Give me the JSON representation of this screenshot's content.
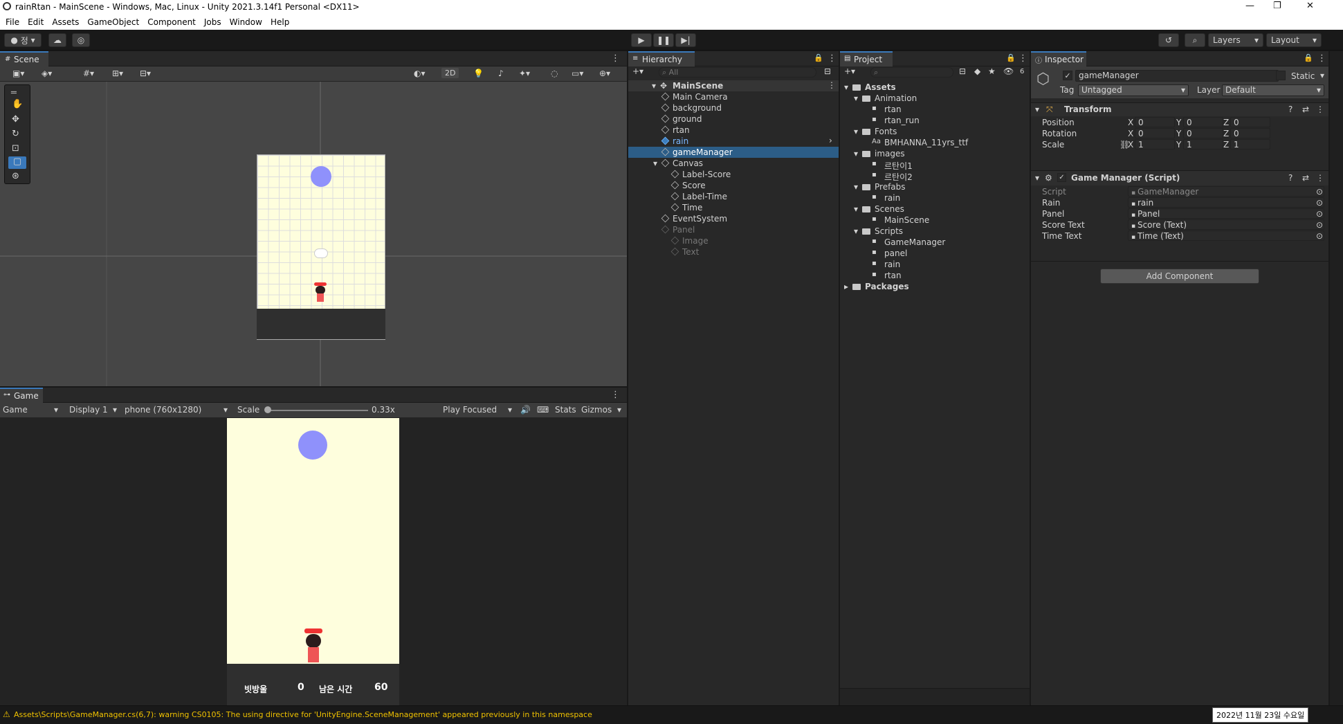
{
  "window": {
    "title": "rainRtan - MainScene - Windows, Mac, Linux - Unity 2021.3.14f1 Personal <DX11>",
    "minimize": "—",
    "restore": "❐",
    "close": "✕"
  },
  "menu": [
    "File",
    "Edit",
    "Assets",
    "GameObject",
    "Component",
    "Jobs",
    "Window",
    "Help"
  ],
  "toolbar": {
    "account": "정",
    "layers": "Layers",
    "layout": "Layout"
  },
  "scene": {
    "tab": "Scene",
    "mode_2d": "2D"
  },
  "game": {
    "tab": "Game",
    "view": "Game",
    "display": "Display 1",
    "resolution": "phone (760x1280)",
    "scale_label": "Scale",
    "scale_value": "0.33x",
    "play_mode": "Play Focused",
    "stats": "Stats",
    "gizmos": "Gizmos",
    "hud": {
      "label_score": "빗방울",
      "score": "0",
      "label_time": "남은 시간",
      "time": "60"
    }
  },
  "hierarchy": {
    "tab": "Hierarchy",
    "search": "All",
    "scene": "MainScene",
    "items": [
      {
        "label": "Main Camera",
        "indent": 1
      },
      {
        "label": "background",
        "indent": 1
      },
      {
        "label": "ground",
        "indent": 1
      },
      {
        "label": "rtan",
        "indent": 1
      },
      {
        "label": "rain",
        "indent": 1,
        "prefab": true
      },
      {
        "label": "gameManager",
        "indent": 1,
        "selected": true
      },
      {
        "label": "Canvas",
        "indent": 1,
        "open": true
      },
      {
        "label": "Label-Score",
        "indent": 2
      },
      {
        "label": "Score",
        "indent": 2
      },
      {
        "label": "Label-Time",
        "indent": 2
      },
      {
        "label": "Time",
        "indent": 2
      },
      {
        "label": "EventSystem",
        "indent": 1
      },
      {
        "label": "Panel",
        "indent": 1,
        "disabled": true
      },
      {
        "label": "Image",
        "indent": 2,
        "disabled": true
      },
      {
        "label": "Text",
        "indent": 2,
        "disabled": true
      }
    ]
  },
  "project": {
    "tab": "Project",
    "hidden_count": "6",
    "items": [
      {
        "label": "Assets",
        "indent": 0,
        "folder": true,
        "bold": true
      },
      {
        "label": "Animation",
        "indent": 1,
        "folder": true
      },
      {
        "label": "rtan",
        "indent": 2
      },
      {
        "label": "rtan_run",
        "indent": 2
      },
      {
        "label": "Fonts",
        "indent": 1,
        "folder": true
      },
      {
        "label": "BMHANNA_11yrs_ttf",
        "indent": 2,
        "prefix": "Aa"
      },
      {
        "label": "images",
        "indent": 1,
        "folder": true
      },
      {
        "label": "르탄이1",
        "indent": 2
      },
      {
        "label": "르탄이2",
        "indent": 2
      },
      {
        "label": "Prefabs",
        "indent": 1,
        "folder": true
      },
      {
        "label": "rain",
        "indent": 2
      },
      {
        "label": "Scenes",
        "indent": 1,
        "folder": true
      },
      {
        "label": "MainScene",
        "indent": 2
      },
      {
        "label": "Scripts",
        "indent": 1,
        "folder": true
      },
      {
        "label": "GameManager",
        "indent": 2
      },
      {
        "label": "panel",
        "indent": 2
      },
      {
        "label": "rain",
        "indent": 2
      },
      {
        "label": "rtan",
        "indent": 2
      },
      {
        "label": "Packages",
        "indent": 0,
        "folder": true,
        "bold": true
      }
    ]
  },
  "inspector": {
    "tab": "Inspector",
    "object_name": "gameManager",
    "static_label": "Static",
    "tag_label": "Tag",
    "tag_value": "Untagged",
    "layer_label": "Layer",
    "layer_value": "Default",
    "transform": {
      "title": "Transform",
      "rows": [
        {
          "label": "Position",
          "x": "0",
          "y": "0",
          "z": "0"
        },
        {
          "label": "Rotation",
          "x": "0",
          "y": "0",
          "z": "0"
        },
        {
          "label": "Scale",
          "x": "1",
          "y": "1",
          "z": "1"
        }
      ]
    },
    "script": {
      "title": "Game Manager (Script)",
      "rows": [
        {
          "label": "Script",
          "value": "GameManager"
        },
        {
          "label": "Rain",
          "value": "rain"
        },
        {
          "label": "Panel",
          "value": "Panel"
        },
        {
          "label": "Score Text",
          "value": "Score (Text)"
        },
        {
          "label": "Time Text",
          "value": "Time (Text)"
        }
      ]
    },
    "add_component": "Add Component"
  },
  "status": {
    "warning": "Assets\\Scripts\\GameManager.cs(6,7): warning CS0105: The using directive for 'UnityEngine.SceneManagement' appeared previously in this namespace",
    "date": "2022년 11월 23일 수요일"
  },
  "colors": {
    "accent": "#3a79bb",
    "selection": "#2c5d87",
    "sky": "#fefedd",
    "rain": "#8f91fb",
    "ground": "#2f2f2f",
    "warning": "#f0c200"
  }
}
